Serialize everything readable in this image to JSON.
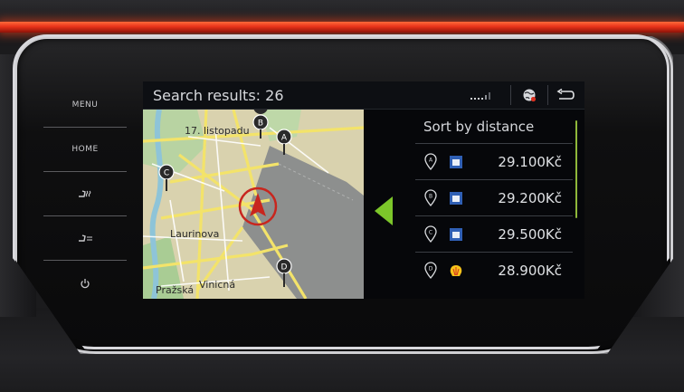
{
  "hardware_buttons": [
    {
      "label": "MENU",
      "icon": null
    },
    {
      "label": "HOME",
      "icon": null
    },
    {
      "label": "",
      "icon": "seat-heat-icon"
    },
    {
      "label": "",
      "icon": "seat-vent-icon"
    },
    {
      "label": "",
      "icon": "power-icon"
    }
  ],
  "status_bar": {
    "title": "Search results: 26",
    "signal_icon": "signal-strength-icon",
    "globe_icon": "online-globe-icon",
    "back_icon": "back-arrow-icon"
  },
  "map": {
    "labels": [
      "17. listopadu",
      "Laurinova",
      "Pražská",
      "Vinicná"
    ],
    "markers": [
      "A",
      "B",
      "C",
      "D"
    ],
    "current_position_icon": "position-arrow-icon"
  },
  "results_panel": {
    "sort_label": "Sort by distance",
    "rows": [
      {
        "marker": "A",
        "brand_icon": "fuel-station-brand-icon",
        "price": "29.100Kč"
      },
      {
        "marker": "B",
        "brand_icon": "fuel-station-brand-icon",
        "price": "29.200Kč"
      },
      {
        "marker": "C",
        "brand_icon": "fuel-station-brand-icon",
        "price": "29.500Kč"
      },
      {
        "marker": "D",
        "brand_icon": "shell-brand-icon",
        "price": "28.900Kč"
      }
    ]
  },
  "colors": {
    "accent_green": "#7cc62a",
    "ambient_red": "#e8331a",
    "screen_bg": "#050608"
  }
}
